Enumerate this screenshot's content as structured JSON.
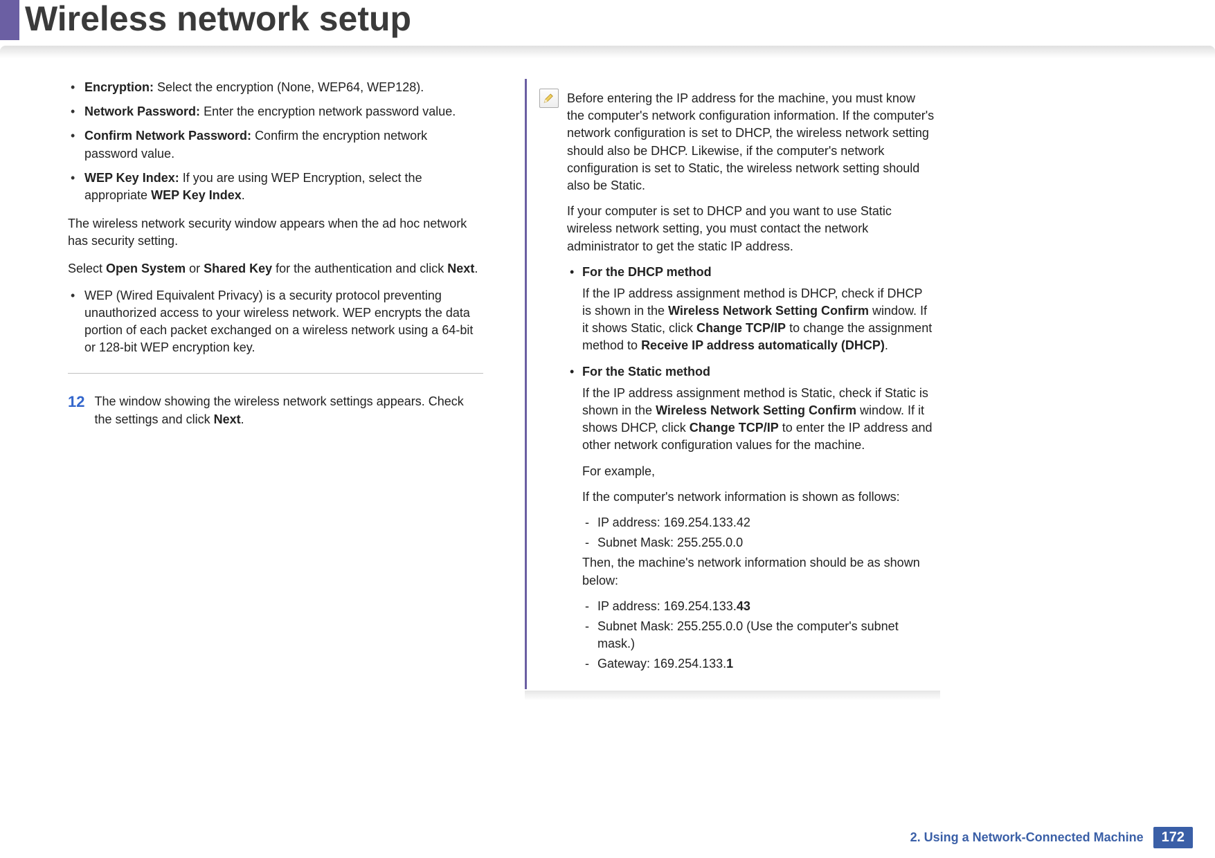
{
  "header": {
    "title": "Wireless network setup"
  },
  "left": {
    "bullets": [
      {
        "label": "Encryption:",
        "text": "Select the encryption (None, WEP64, WEP128)."
      },
      {
        "label": "Network Password:",
        "text": "Enter the encryption network password value."
      },
      {
        "label": "Confirm Network Password:",
        "text": "Confirm the encryption network password value."
      },
      {
        "label": "WEP Key Index:",
        "text_pre": "If you are using WEP Encryption, select the appropriate ",
        "bold_tail": "WEP Key Index",
        "text_post": "."
      }
    ],
    "para1": "The wireless network security window appears when the ad hoc network has security setting.",
    "para2_pre": "Select ",
    "para2_b1": "Open System",
    "para2_mid": " or ",
    "para2_b2": "Shared Key",
    "para2_post": " for the authentication and click ",
    "para2_b3": "Next",
    "para2_end": ".",
    "wep_bullet": "WEP (Wired Equivalent Privacy) is a security protocol preventing unauthorized access to your wireless network. WEP encrypts the data portion of each packet exchanged on a wireless network using a 64-bit or 128-bit WEP encryption key.",
    "step": {
      "num": "12",
      "text_pre": "The window showing the wireless network settings appears. Check the settings and click ",
      "bold": "Next",
      "text_post": "."
    }
  },
  "right": {
    "intro1": "Before entering the IP address for the machine, you must know the computer's network configuration information. If the computer's network configuration is set to DHCP, the wireless network setting should also be DHCP. Likewise, if the computer's network configuration is set to Static, the wireless network setting should also be Static.",
    "intro2": "If your computer is set to DHCP and you want to use Static wireless network setting, you must contact the network administrator to get the static IP address.",
    "dhcp": {
      "title": "For the DHCP method",
      "pre": "If the IP address assignment method is DHCP, check if DHCP is shown in the ",
      "b1": "Wireless Network Setting Confirm",
      "mid1": " window. If it shows Static, click ",
      "b2": "Change TCP/IP",
      "mid2": " to change the assignment method to ",
      "b3": "Receive IP address automatically (DHCP)",
      "end": "."
    },
    "static": {
      "title": "For the Static method",
      "pre": "If the IP address assignment method is Static, check if Static is shown in the ",
      "b1": "Wireless Network Setting Confirm",
      "mid1": " window. If it shows DHCP, click ",
      "b2": "Change TCP/IP",
      "mid2": " to enter the IP address and other network configuration values for the machine.",
      "example_label": "For example,",
      "example_intro": "If the computer's network information is shown as follows:",
      "comp_ip": "IP address: 169.254.133.42",
      "comp_mask": "Subnet Mask: 255.255.0.0",
      "then": "Then, the machine's network information should be as shown below:",
      "mach_ip_pre": "IP address: 169.254.133.",
      "mach_ip_bold": "43",
      "mach_mask": "Subnet Mask: 255.255.0.0 (Use the computer's subnet mask.)",
      "mach_gw_pre": "Gateway: 169.254.133.",
      "mach_gw_bold": "1"
    }
  },
  "footer": {
    "chapter": "2.  Using a Network-Connected Machine",
    "page": "172"
  }
}
